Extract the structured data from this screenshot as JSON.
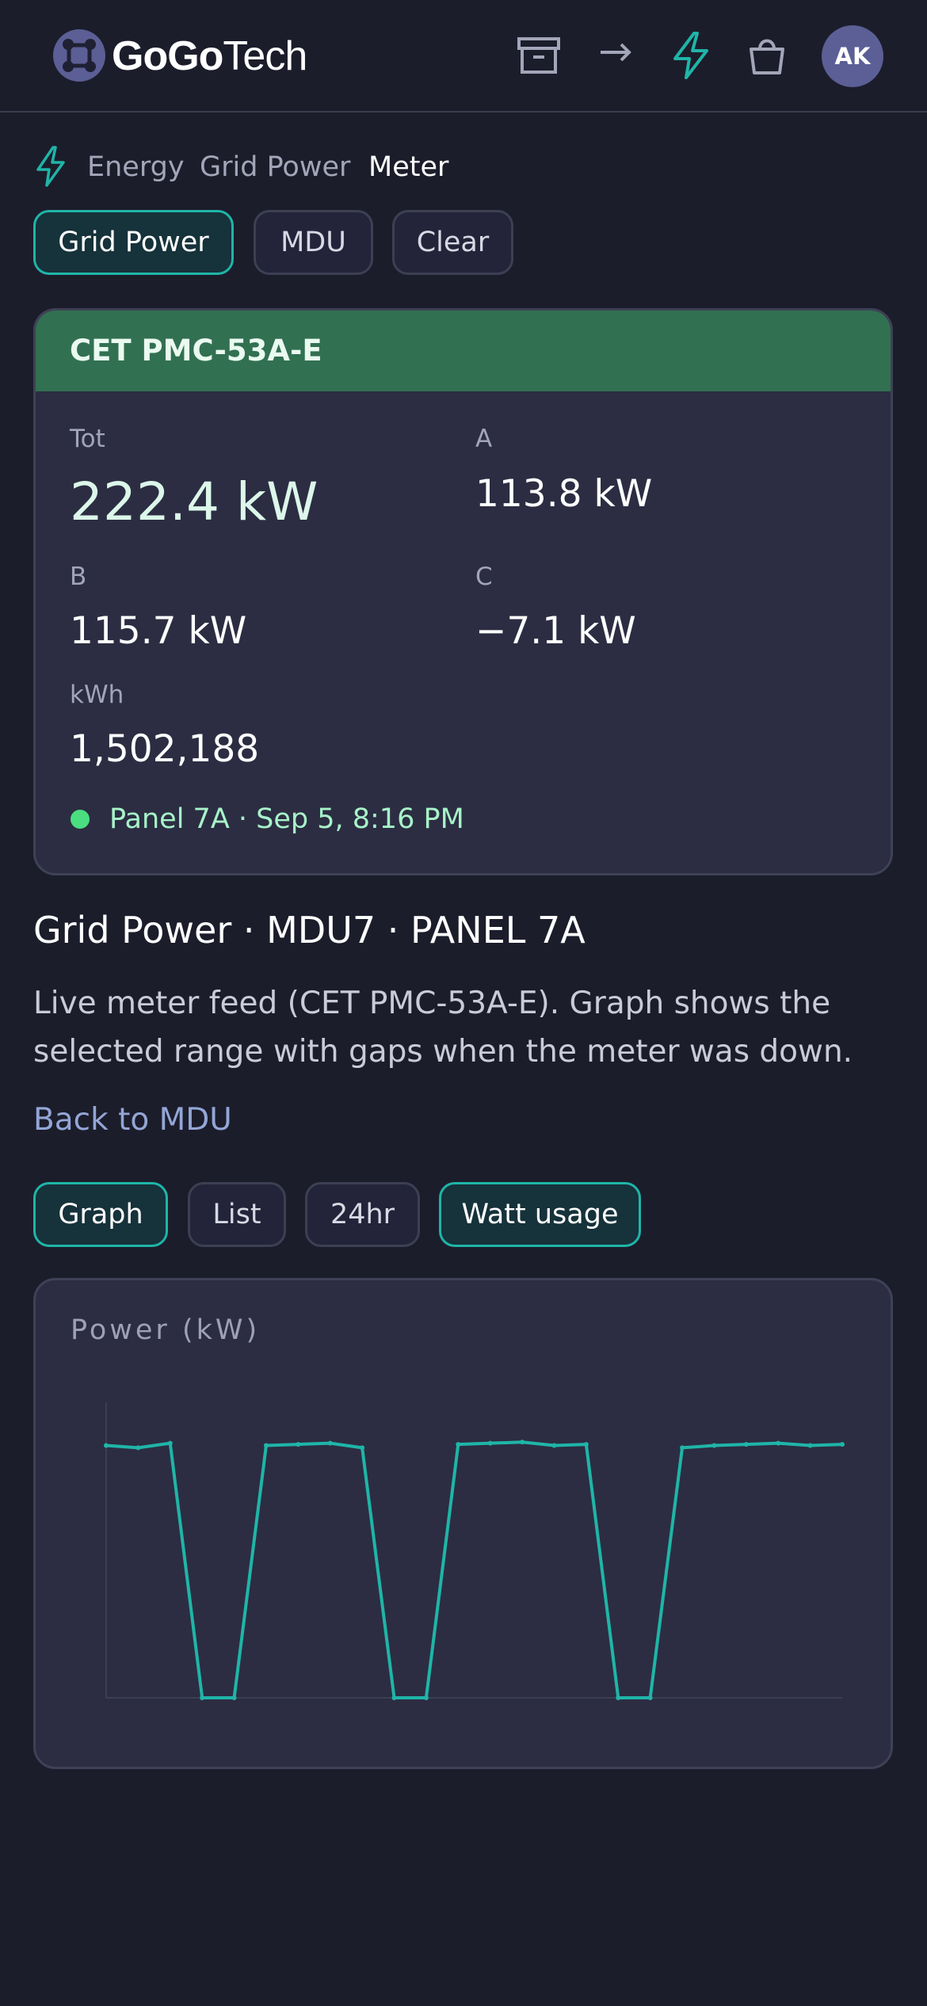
{
  "header": {
    "logo_bold": "GoGo",
    "logo_regular": "Tech",
    "avatar_initials": "AK"
  },
  "breadcrumb": [
    "Energy",
    "Grid Power",
    "Meter"
  ],
  "filter_pills": [
    {
      "label": "Grid Power",
      "active": true
    },
    {
      "label": "MDU",
      "active": false
    },
    {
      "label": "Clear",
      "active": false
    }
  ],
  "meter_card": {
    "title": "CET PMC-53A-E",
    "tot_label": "Tot",
    "tot_value": "222.4 kW",
    "a_label": "A",
    "a_value": "113.8 kW",
    "b_label": "B",
    "b_value": "115.7 kW",
    "c_label": "C",
    "c_value": "−7.1 kW",
    "kwh_label": "kWh",
    "kwh_value": "1,502,188",
    "status": "Panel 7A · Sep 5, 8:16 PM"
  },
  "info": {
    "title": "Grid Power · MDU7 · PANEL 7A",
    "description": "Live meter feed (CET PMC-53A-E). Graph shows the selected range with gaps when the meter was down.",
    "back_link": "Back to MDU"
  },
  "view_pills": [
    {
      "label": "Graph",
      "active": true
    },
    {
      "label": "List",
      "active": false
    },
    {
      "label": "24hr",
      "active": false
    },
    {
      "label": "Watt usage",
      "active": true
    }
  ],
  "colors": {
    "accent": "#1fb5a8",
    "card_header": "#327052",
    "status_ok": "#4ade80"
  },
  "chart_data": {
    "type": "line",
    "title": "Power (kW)",
    "ylim": [
      0,
      260
    ],
    "series": [
      {
        "values": [
          222,
          220,
          224,
          0,
          0,
          222,
          223,
          224,
          220,
          0,
          0,
          223,
          224,
          225,
          222,
          223,
          0,
          0,
          220,
          222,
          223,
          224,
          222,
          223
        ]
      }
    ]
  }
}
